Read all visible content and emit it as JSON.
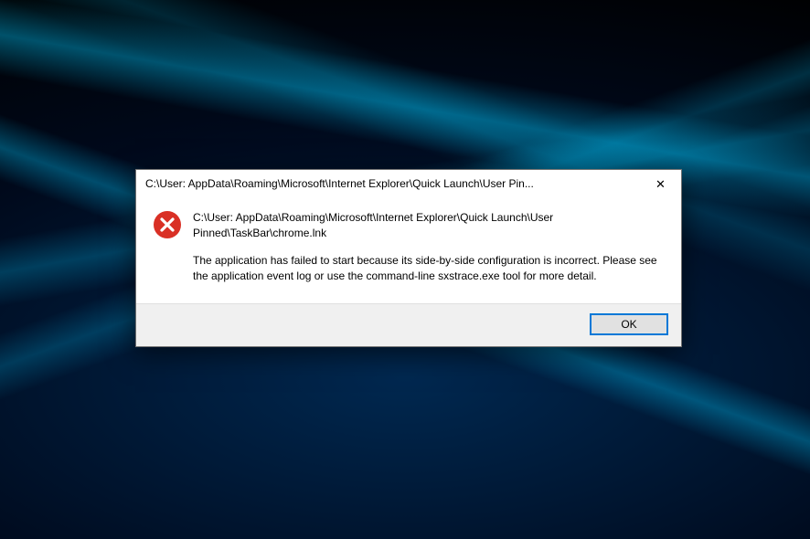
{
  "dialog": {
    "title": "C:\\User:                           AppData\\Roaming\\Microsoft\\Internet Explorer\\Quick Launch\\User Pin...",
    "close_glyph": "✕",
    "icon_name": "error-icon",
    "message_path": "C:\\User:                                AppData\\Roaming\\Microsoft\\Internet Explorer\\Quick Launch\\User Pinned\\TaskBar\\chrome.lnk",
    "message_body": "The application has failed to start because its side-by-side configuration is incorrect. Please see the application event log or use the command-line sxstrace.exe tool for more detail.",
    "ok_label": "OK"
  },
  "colors": {
    "error_red": "#d93025",
    "focus_blue": "#0078d7"
  }
}
